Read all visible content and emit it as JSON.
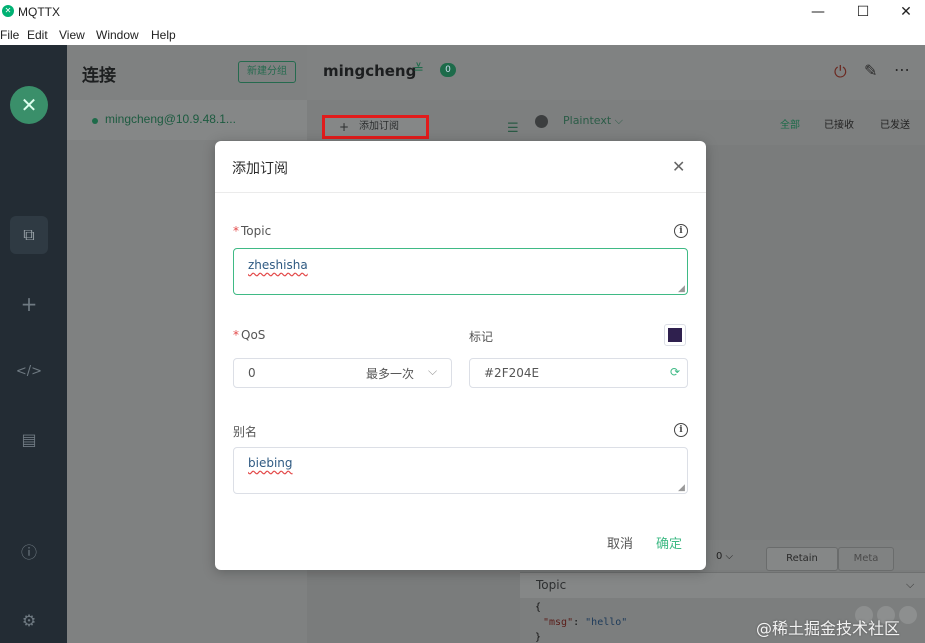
{
  "window": {
    "title": "MQTTX",
    "minimize": "—",
    "maximize": "☐",
    "close": "✕"
  },
  "menu": [
    "File",
    "Edit",
    "View",
    "Window",
    "Help"
  ],
  "sidebar": {
    "logo": "✕",
    "icons": [
      "copy-icon",
      "plus-icon",
      "code-icon",
      "log-icon",
      "info-icon",
      "settings-icon"
    ]
  },
  "connections": {
    "title": "连接",
    "new_group_label": "新建分组",
    "items": [
      {
        "name": "mingcheng@10.9.48.1...",
        "status": "connected"
      }
    ]
  },
  "main": {
    "client_name": "mingcheng",
    "message_count": "0",
    "add_subscription_label": "添加订阅",
    "payload_format": "Plaintext",
    "filters": [
      "全部",
      "已接收",
      "已发送"
    ],
    "publish": {
      "qos": "0",
      "retain_label": "Retain",
      "meta_label": "Meta",
      "topic_placeholder": "Topic",
      "payload_lines": [
        "{",
        "\"msg\": \"hello\"",
        "}"
      ],
      "payload_key": "\"msg\"",
      "payload_sep": ": ",
      "payload_val": "\"hello\""
    }
  },
  "dialog": {
    "title": "添加订阅",
    "topic_label": "Topic",
    "topic_value": "zheshisha",
    "qos_label": "QoS",
    "qos_value": "0",
    "qos_description": "最多一次",
    "color_label": "标记",
    "color_value": "#2F204E",
    "alias_label": "别名",
    "alias_value": "biebing",
    "cancel_label": "取消",
    "confirm_label": "确定"
  },
  "colors": {
    "accent": "#3fba85",
    "highlight_box": "#e21b1b",
    "mark_color": "#2F204E",
    "rail": "#232c34"
  },
  "watermark": "@稀土掘金技术社区"
}
